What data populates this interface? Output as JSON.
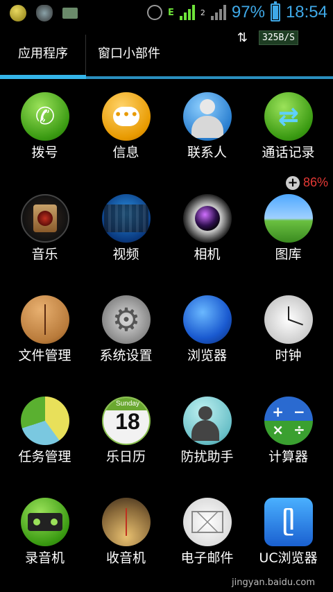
{
  "status_bar": {
    "battery_percent": "97%",
    "battery_level": 0.97,
    "time": "18:54",
    "network_type": "E",
    "sim2_badge": "2"
  },
  "tabs": {
    "apps": "应用程序",
    "widgets": "窗口小部件",
    "net_speed": "325B/S"
  },
  "memory_indicator": {
    "percent": "86%"
  },
  "apps": [
    {
      "label": "拨号"
    },
    {
      "label": "信息"
    },
    {
      "label": "联系人"
    },
    {
      "label": "通话记录"
    },
    {
      "label": "音乐"
    },
    {
      "label": "视频"
    },
    {
      "label": "相机"
    },
    {
      "label": "图库"
    },
    {
      "label": "文件管理"
    },
    {
      "label": "系统设置"
    },
    {
      "label": "浏览器"
    },
    {
      "label": "时钟"
    },
    {
      "label": "任务管理"
    },
    {
      "label": "乐日历"
    },
    {
      "label": "防扰助手"
    },
    {
      "label": "计算器"
    },
    {
      "label": "录音机"
    },
    {
      "label": "收音机"
    },
    {
      "label": "电子邮件"
    },
    {
      "label": "UC浏览器"
    }
  ],
  "calendar_icon": {
    "weekday": "Sunday",
    "day": "18"
  },
  "watermark": "jingyan.baidu.com"
}
